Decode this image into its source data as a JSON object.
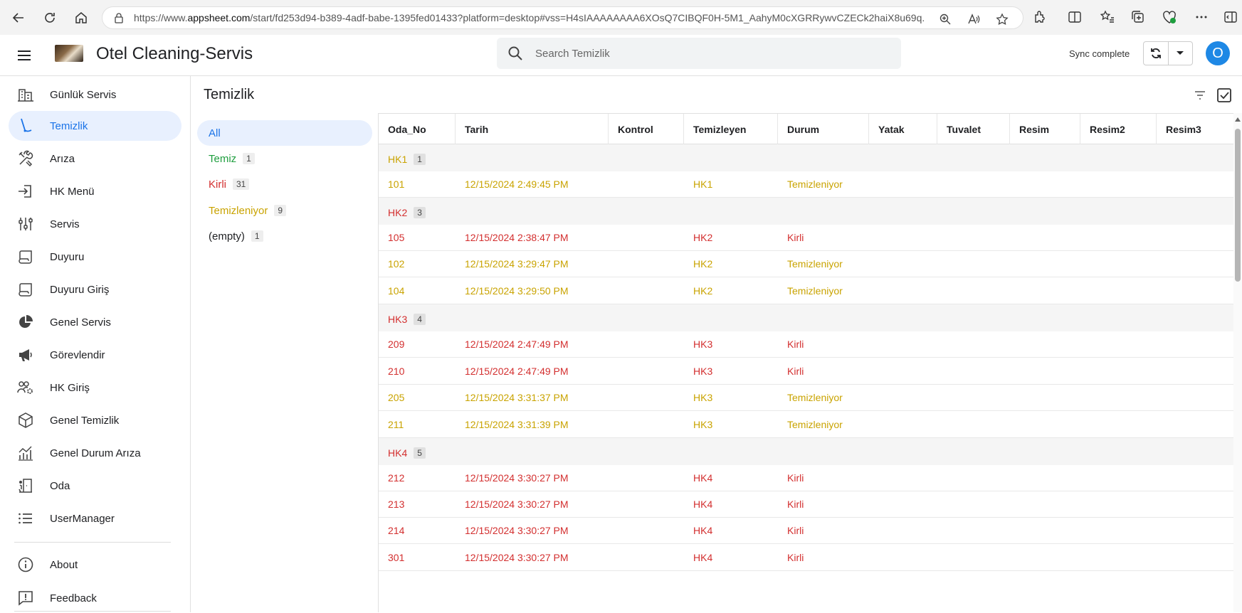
{
  "browser": {
    "url_prefix": "https://www.",
    "url_domain": "appsheet.com",
    "url_rest": "/start/fd253d94-b389-4adf-babe-1395fed01433?platform=desktop#vss=H4sIAAAAAAAA6XOsQ7CIBQF0H-5M1_AahyM0cXGRRywvCZECk2haiX8u69q..."
  },
  "header": {
    "title": "Otel Cleaning-Servis",
    "search_placeholder": "Search Temizlik",
    "sync_status": "Sync complete",
    "avatar_initial": "O"
  },
  "sidebar": {
    "items": [
      {
        "label": "Günlük Servis",
        "icon": "building-icon"
      },
      {
        "label": "Temizlik",
        "icon": "vacuum-icon"
      },
      {
        "label": "Arıza",
        "icon": "tools-icon"
      },
      {
        "label": "HK Menü",
        "icon": "login-icon"
      },
      {
        "label": "Servis",
        "icon": "sliders-icon"
      },
      {
        "label": "Duyuru",
        "icon": "scroll-icon"
      },
      {
        "label": "Duyuru Giriş",
        "icon": "scroll-icon"
      },
      {
        "label": "Genel Servis",
        "icon": "pie-chart-icon"
      },
      {
        "label": "Görevlendir",
        "icon": "megaphone-icon"
      },
      {
        "label": "HK Giriş",
        "icon": "users-gear-icon"
      },
      {
        "label": "Genel Temizlik",
        "icon": "cube-icon"
      },
      {
        "label": "Genel Durum Arıza",
        "icon": "bar-chart-icon"
      },
      {
        "label": "Oda",
        "icon": "room-icon"
      },
      {
        "label": "UserManager",
        "icon": "list-icon"
      }
    ],
    "footer": [
      {
        "label": "About",
        "icon": "info-icon"
      },
      {
        "label": "Feedback",
        "icon": "feedback-icon"
      }
    ]
  },
  "main": {
    "title": "Temizlik"
  },
  "groups": [
    {
      "label": "All",
      "count": "",
      "color": "#1a73e8"
    },
    {
      "label": "Temiz",
      "count": "1",
      "color": "#1e9e3e"
    },
    {
      "label": "Kirli",
      "count": "31",
      "color": "#d32f2f"
    },
    {
      "label": "Temizleniyor",
      "count": "9",
      "color": "#c9a300"
    },
    {
      "label": "(empty)",
      "count": "1",
      "color": "#202124"
    }
  ],
  "columns": [
    "Oda_No",
    "Tarih",
    "Kontrol",
    "Temizleyen",
    "Durum",
    "Yatak",
    "Tuvalet",
    "Resim",
    "Resim2",
    "Resim3"
  ],
  "table_groups": [
    {
      "label": "HK1",
      "count": "1",
      "color": "yellow",
      "rows": [
        {
          "oda": "101",
          "tarih": "12/15/2024 2:49:45 PM",
          "temizleyen": "HK1",
          "durum": "Temizleniyor",
          "color": "yellow"
        }
      ]
    },
    {
      "label": "HK2",
      "count": "3",
      "color": "red",
      "rows": [
        {
          "oda": "105",
          "tarih": "12/15/2024 2:38:47 PM",
          "temizleyen": "HK2",
          "durum": "Kirli",
          "color": "red"
        },
        {
          "oda": "102",
          "tarih": "12/15/2024 3:29:47 PM",
          "temizleyen": "HK2",
          "durum": "Temizleniyor",
          "color": "yellow"
        },
        {
          "oda": "104",
          "tarih": "12/15/2024 3:29:50 PM",
          "temizleyen": "HK2",
          "durum": "Temizleniyor",
          "color": "yellow"
        }
      ]
    },
    {
      "label": "HK3",
      "count": "4",
      "color": "red",
      "rows": [
        {
          "oda": "209",
          "tarih": "12/15/2024 2:47:49 PM",
          "temizleyen": "HK3",
          "durum": "Kirli",
          "color": "red"
        },
        {
          "oda": "210",
          "tarih": "12/15/2024 2:47:49 PM",
          "temizleyen": "HK3",
          "durum": "Kirli",
          "color": "red"
        },
        {
          "oda": "205",
          "tarih": "12/15/2024 3:31:37 PM",
          "temizleyen": "HK3",
          "durum": "Temizleniyor",
          "color": "yellow"
        },
        {
          "oda": "211",
          "tarih": "12/15/2024 3:31:39 PM",
          "temizleyen": "HK3",
          "durum": "Temizleniyor",
          "color": "yellow"
        }
      ]
    },
    {
      "label": "HK4",
      "count": "5",
      "color": "red",
      "rows": [
        {
          "oda": "212",
          "tarih": "12/15/2024 3:30:27 PM",
          "temizleyen": "HK4",
          "durum": "Kirli",
          "color": "red"
        },
        {
          "oda": "213",
          "tarih": "12/15/2024 3:30:27 PM",
          "temizleyen": "HK4",
          "durum": "Kirli",
          "color": "red"
        },
        {
          "oda": "214",
          "tarih": "12/15/2024 3:30:27 PM",
          "temizleyen": "HK4",
          "durum": "Kirli",
          "color": "red"
        },
        {
          "oda": "301",
          "tarih": "12/15/2024 3:30:27 PM",
          "temizleyen": "HK4",
          "durum": "Kirli",
          "color": "red"
        }
      ]
    }
  ]
}
